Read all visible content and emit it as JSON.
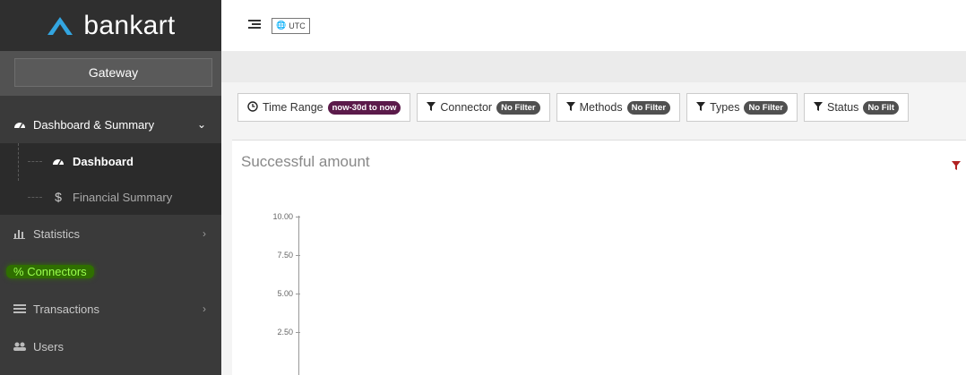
{
  "brand": {
    "name": "bankart"
  },
  "sidebar": {
    "gateway_label": "Gateway",
    "dashboard_group": "Dashboard & Summary",
    "sub_items": [
      "Dashboard",
      "Financial Summary"
    ],
    "statistics": "Statistics",
    "connectors": "Connectors",
    "transactions": "Transactions",
    "users": "Users"
  },
  "topbar": {
    "timezone": "UTC"
  },
  "filters": {
    "time_range": {
      "label": "Time Range",
      "value": "now-30d to now"
    },
    "connector": {
      "label": "Connector",
      "value": "No Filter"
    },
    "methods": {
      "label": "Methods",
      "value": "No Filter"
    },
    "types": {
      "label": "Types",
      "value": "No Filter"
    },
    "status": {
      "label": "Status",
      "value": "No Filt"
    }
  },
  "panel": {
    "title": "Successful amount"
  },
  "chart_data": {
    "type": "line",
    "title": "Successful amount",
    "ylabel": "",
    "xlabel": "",
    "yticks": [
      "10.00",
      "7.50",
      "5.00",
      "2.50"
    ],
    "ylim": [
      0,
      10
    ],
    "series": []
  },
  "colors": {
    "highlight": "#2f6f00",
    "time_pill": "#5b1a4a",
    "filter_icon": "#b22222"
  }
}
